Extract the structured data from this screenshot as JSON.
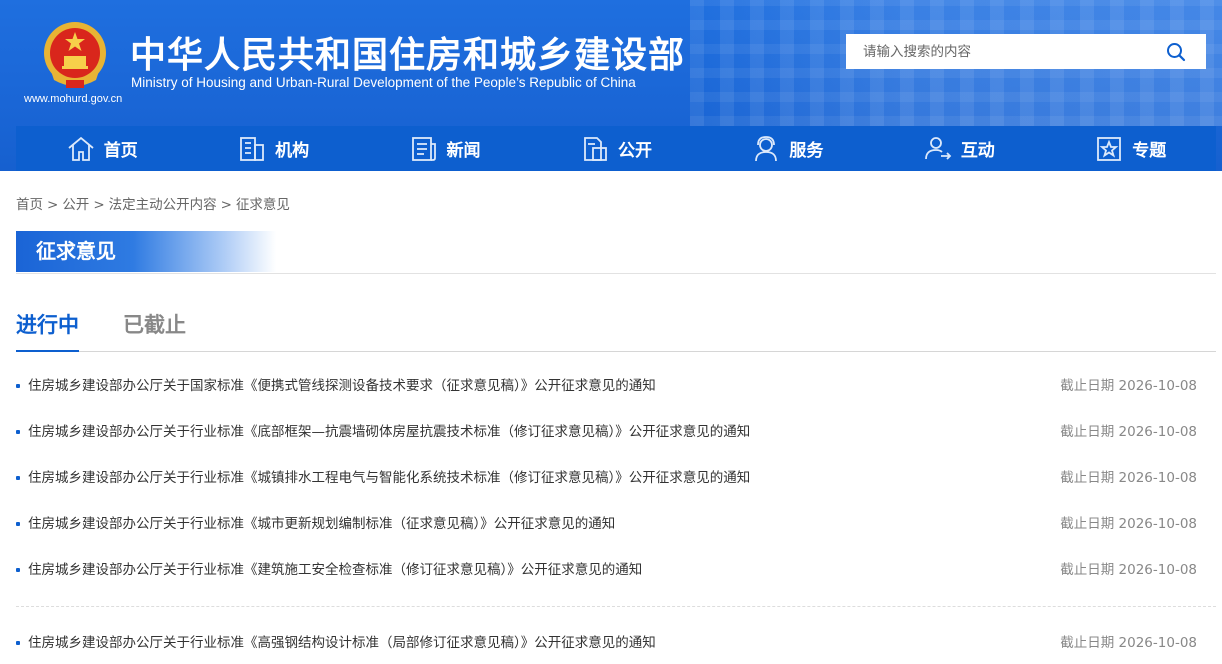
{
  "header": {
    "title": "中华人民共和国住房和城乡建设部",
    "subtitle": "Ministry of Housing and Urban-Rural Development of the People’s Republic of China",
    "url": "www.mohurd.gov.cn",
    "search_placeholder": "请输入搜索的内容",
    "brand_color": "#1a66d6"
  },
  "nav": [
    {
      "label": "首页",
      "icon": "home-icon"
    },
    {
      "label": "机构",
      "icon": "building-icon"
    },
    {
      "label": "新闻",
      "icon": "news-icon"
    },
    {
      "label": "公开",
      "icon": "document-icon"
    },
    {
      "label": "服务",
      "icon": "service-user-icon"
    },
    {
      "label": "互动",
      "icon": "interaction-user-icon"
    },
    {
      "label": "专题",
      "icon": "star-box-icon"
    }
  ],
  "breadcrumb": [
    "首页",
    "公开",
    "法定主动公开内容",
    "征求意见"
  ],
  "breadcrumb_sep": ">",
  "section_title": "征求意见",
  "tabs": {
    "active": "进行中",
    "inactive": "已截止"
  },
  "items_group1": [
    {
      "title": "住房城乡建设部办公厅关于国家标准《便携式管线探测设备技术要求（征求意见稿）》公开征求意见的通知",
      "date": "截止日期 2026-10-08"
    },
    {
      "title": "住房城乡建设部办公厅关于行业标准《底部框架—抗震墙砌体房屋抗震技术标准（修订征求意见稿）》公开征求意见的通知",
      "date": "截止日期 2026-10-08"
    },
    {
      "title": "住房城乡建设部办公厅关于行业标准《城镇排水工程电气与智能化系统技术标准（修订征求意见稿）》公开征求意见的通知",
      "date": "截止日期 2026-10-08"
    },
    {
      "title": "住房城乡建设部办公厅关于行业标准《城市更新规划编制标准（征求意见稿）》公开征求意见的通知",
      "date": "截止日期 2026-10-08"
    },
    {
      "title": "住房城乡建设部办公厅关于行业标准《建筑施工安全检查标准（修订征求意见稿）》公开征求意见的通知",
      "date": "截止日期 2026-10-08"
    }
  ],
  "items_group2": [
    {
      "title": "住房城乡建设部办公厅关于行业标准《高强钢结构设计标准（局部修订征求意见稿）》公开征求意见的通知",
      "date": "截止日期 2026-10-08"
    }
  ]
}
